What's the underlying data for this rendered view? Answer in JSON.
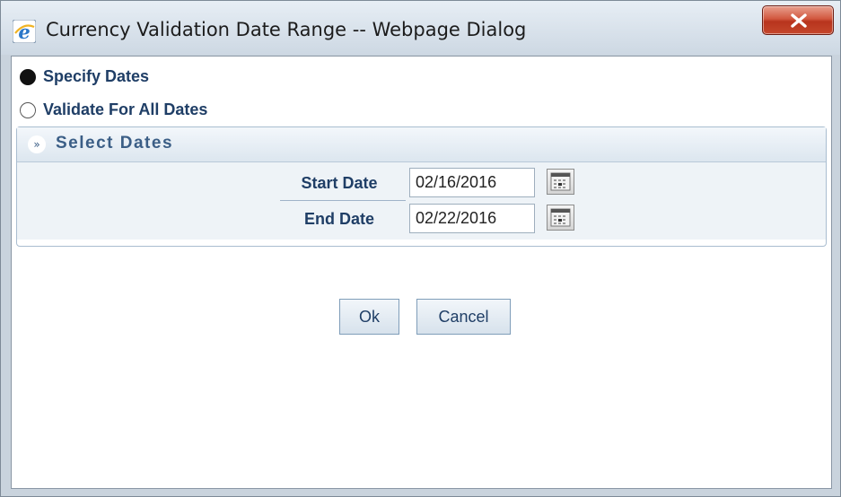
{
  "window": {
    "title": "Currency Validation Date Range -- Webpage Dialog"
  },
  "options": {
    "specify_dates": {
      "label": "Specify Dates",
      "selected": true
    },
    "validate_all_dates": {
      "label": "Validate For All Dates",
      "selected": false
    }
  },
  "section": {
    "title": "Select Dates",
    "start_date": {
      "label": "Start Date",
      "value": "02/16/2016"
    },
    "end_date": {
      "label": "End Date",
      "value": "02/22/2016"
    }
  },
  "buttons": {
    "ok_label": "Ok",
    "cancel_label": "Cancel"
  },
  "colors": {
    "label_text": "#1f3e66",
    "section_title": "#3b5e86",
    "close_button": "#c5472c"
  },
  "icons": {
    "window_icon": "internet-explorer-icon",
    "close": "close-icon",
    "collapse": "collapse-chevron-up-icon",
    "calendar": "calendar-icon"
  }
}
